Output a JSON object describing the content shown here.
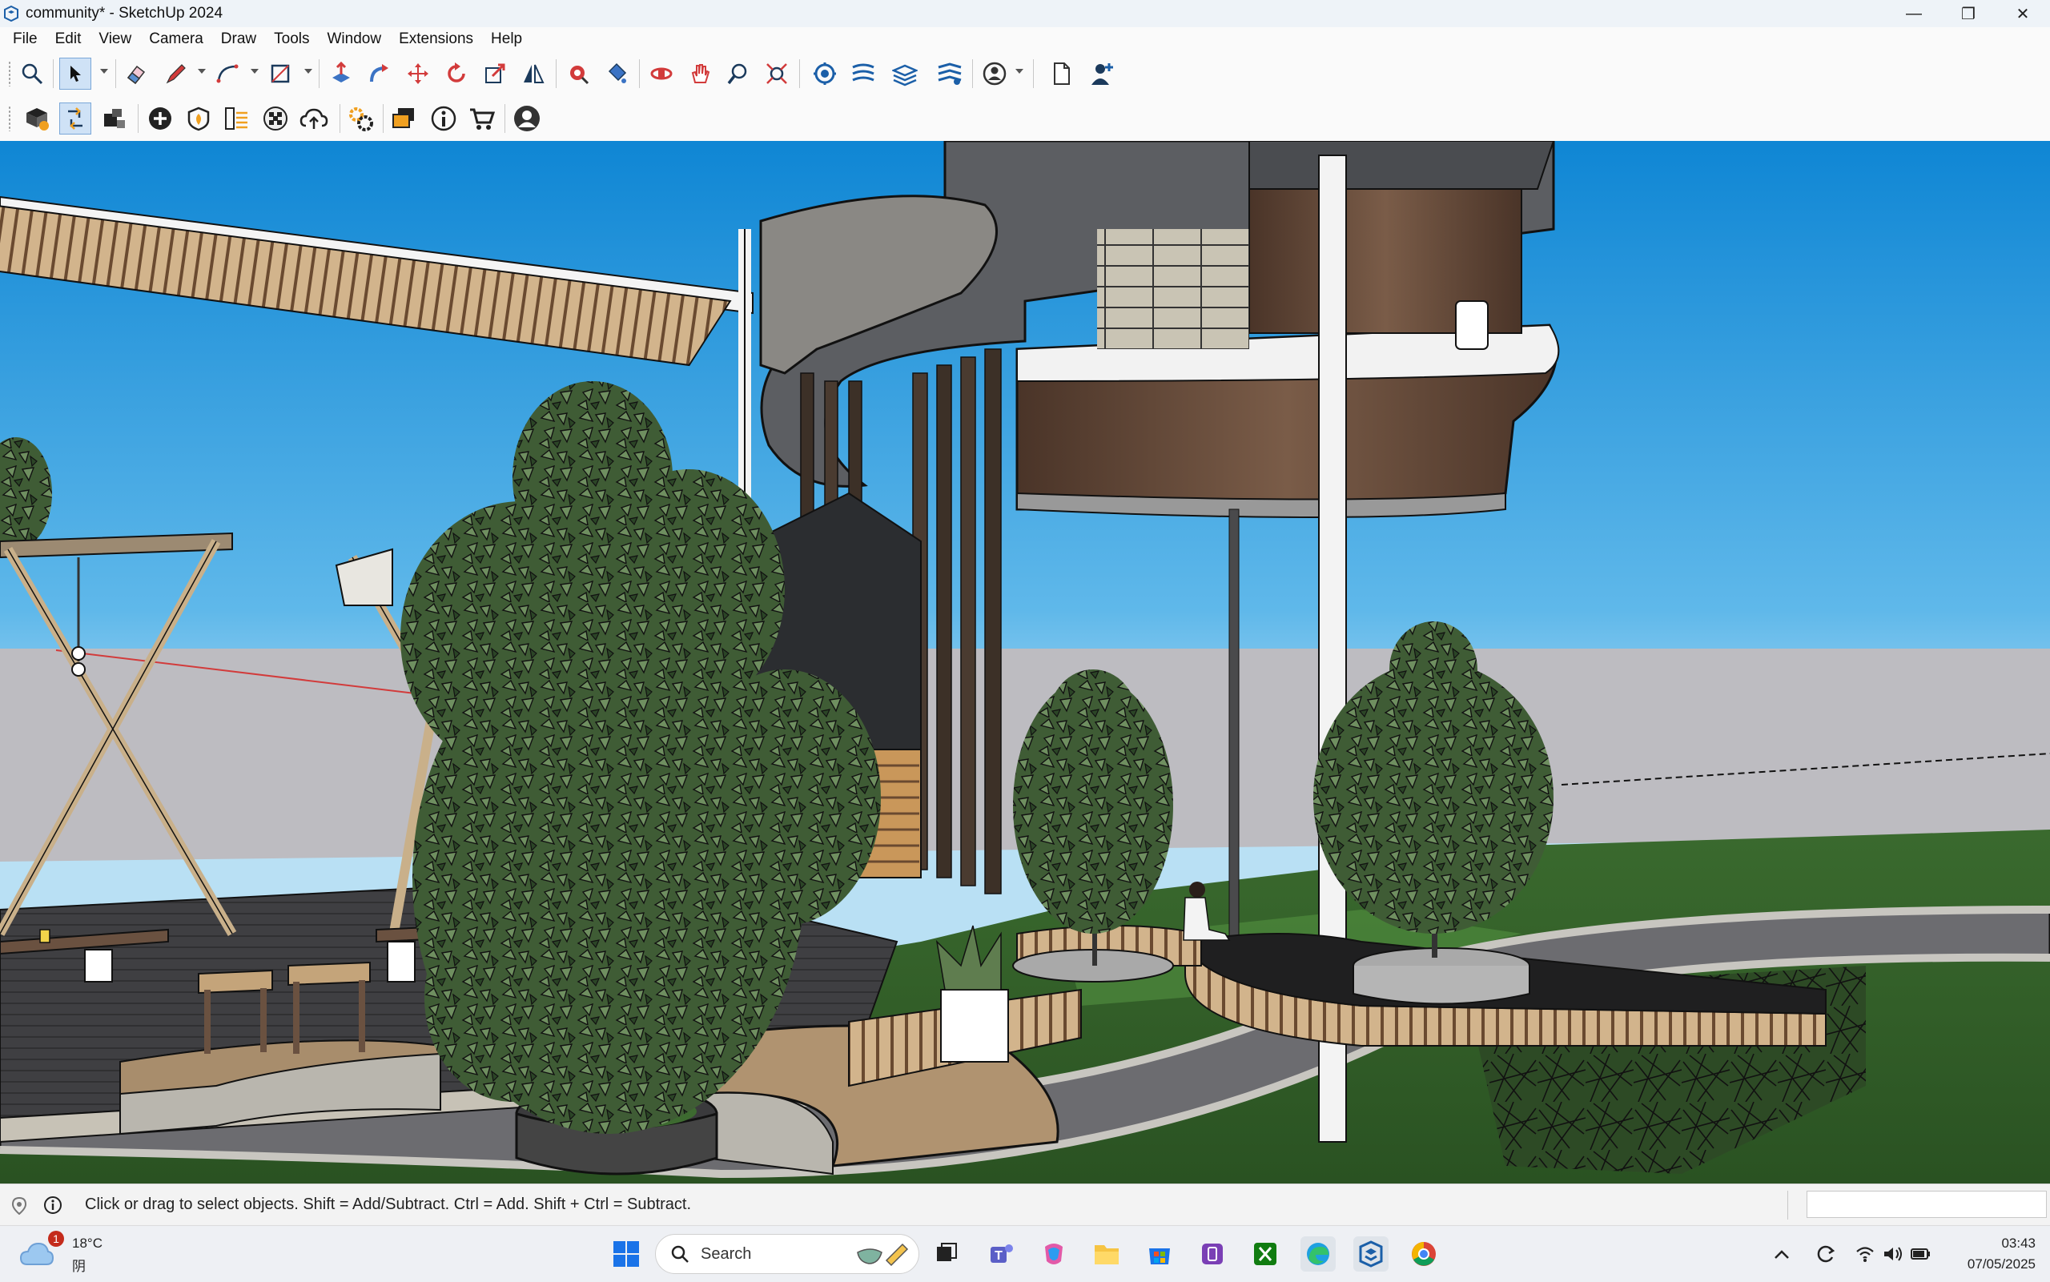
{
  "window": {
    "title": "community* - SketchUp 2024",
    "minimize": "—",
    "restore": "❐",
    "close": "✕"
  },
  "menu": [
    "File",
    "Edit",
    "View",
    "Camera",
    "Draw",
    "Tools",
    "Window",
    "Extensions",
    "Help"
  ],
  "toolbar1_icons": [
    "zoom-icon",
    "select-arrow-icon",
    "eraser-icon",
    "pencil-line-icon",
    "arc-icon",
    "rectangle-icon",
    "push-pull-icon",
    "follow-me-icon",
    "move-icon",
    "rotate-icon",
    "scale-icon",
    "flip-icon",
    "tape-measure-icon",
    "paint-bucket-icon",
    "orbit-icon",
    "pan-icon",
    "zoom-tool-icon",
    "zoom-extents-icon",
    "solid-tools-icon",
    "sandbox-icon",
    "layers-icon",
    "scene-icon",
    "account-icon",
    "new-file-icon",
    "add-user-icon"
  ],
  "toolbar2_icons": [
    "warehouse-icon",
    "components-icon",
    "styles-icon",
    "add-location-icon",
    "geo-icon",
    "tags-icon",
    "texture-icon",
    "cloud-upload-icon",
    "extension-manager-icon",
    "outliner-icon",
    "entity-info-icon",
    "extension-warehouse-icon",
    "profile-icon"
  ],
  "status": {
    "text": "Click or drag to select objects. Shift = Add/Subtract. Ctrl = Add. Shift + Ctrl = Subtract.",
    "measurements_value": ""
  },
  "taskbar": {
    "weather_temp": "18°C",
    "weather_condition": "阴",
    "weather_badge": "1",
    "search_placeholder": "Search",
    "time": "03:43",
    "date": "07/05/2025"
  },
  "colors": {
    "sky_top": "#1a8fd6",
    "sky_bottom": "#a9d9f0",
    "ground": "#3c6b2f",
    "wood": "#6b5140",
    "path": "#6f6f6f"
  }
}
